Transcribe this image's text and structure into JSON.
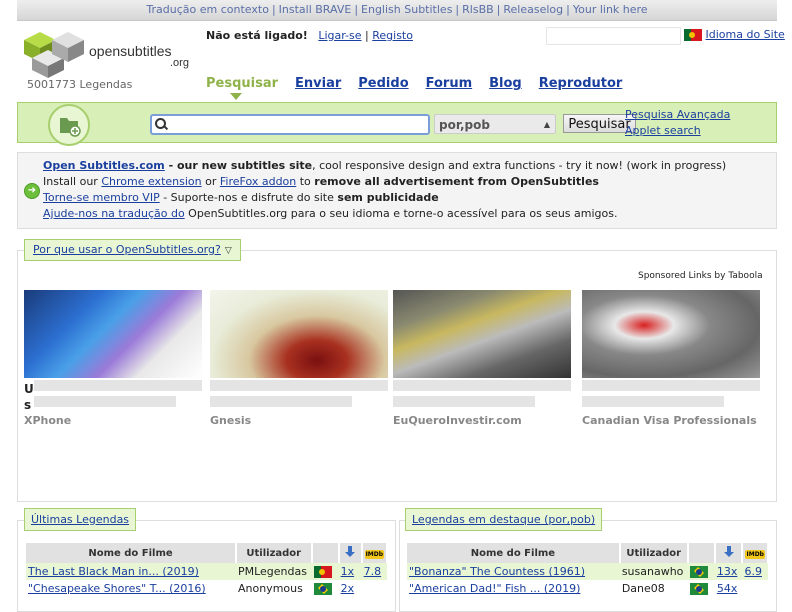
{
  "topbar": {
    "links": [
      "Tradução em contexto",
      "Install BRAVE",
      "English Subtitles",
      "RlsBB",
      "Releaselog",
      "Your link here"
    ]
  },
  "logo": {
    "line1": "opensubtitles",
    "line2": ".org"
  },
  "count_text": "5001773 Legendas",
  "login": {
    "status": "Não está ligado!",
    "login_link": "Ligar-se",
    "register_link": "Registo"
  },
  "lang_link": "Idioma do Site",
  "nav": [
    "Pesquisar",
    "Enviar",
    "Pedido",
    "Forum",
    "Blog",
    "Reprodutor"
  ],
  "search": {
    "input_value": "",
    "select_value": "por,pob",
    "button_label": "Pesquisar",
    "advanced_link": "Pesquisa Avançada",
    "applet_link": "Applet search"
  },
  "info": {
    "line1_link": "Open Subtitles.com",
    "line1_bold": " - our new subtitles site",
    "line1_rest": ", cool responsive design and extra functions - try it now! (work in progress)",
    "line2_pre": "Install our ",
    "line2_link1": "Chrome extension",
    "line2_mid": " or ",
    "line2_link2": "FireFox addon",
    "line2_to": " to ",
    "line2_bold": "remove all advertisement from OpenSubtitles",
    "line3_link": "Torne-se membro VIP",
    "line3_rest": " - Suporte-nos e disfrute do site ",
    "line3_bold": "sem publicidade",
    "line4_link": "Ajude-nos na tradução do",
    "line4_rest": " OpenSubtitles.org para o seu idioma e torne-o acessível para os seus amigos."
  },
  "why_tab": "Por que usar o OpenSubtitles.org?",
  "sponsored": "Sponsored Links by Taboola",
  "ads": [
    {
      "source": "XPhone",
      "title_start_1": "U",
      "title_start_2": "s"
    },
    {
      "source": "Gnesis"
    },
    {
      "source": "EuQueroInvestir.com"
    },
    {
      "source": "Canadian Visa Professionals"
    }
  ],
  "latest": {
    "tab": "Últimas Legendas",
    "headers": [
      "Nome do Filme",
      "Utilizador"
    ],
    "rows": [
      {
        "title": "The Last Black Man in... (2019)",
        "user": "PMLegendas",
        "downloads": "1x",
        "rating": "7.8"
      },
      {
        "title": "\"Chesapeake Shores\" T... (2016)",
        "user": "Anonymous",
        "downloads": "2x",
        "rating": ""
      }
    ]
  },
  "featured": {
    "tab": "Legendas em destaque (por,pob)",
    "headers": [
      "Nome do Filme",
      "Utilizador"
    ],
    "rows": [
      {
        "title": "\"Bonanza\" The Countess (1961)",
        "user": "susanawho",
        "downloads": "13x",
        "rating": "6.9"
      },
      {
        "title": "\"American Dad!\" Fish ... (2019)",
        "user": "Dane08",
        "downloads": "54x",
        "rating": ""
      }
    ]
  },
  "imdb_label": "IMDb"
}
